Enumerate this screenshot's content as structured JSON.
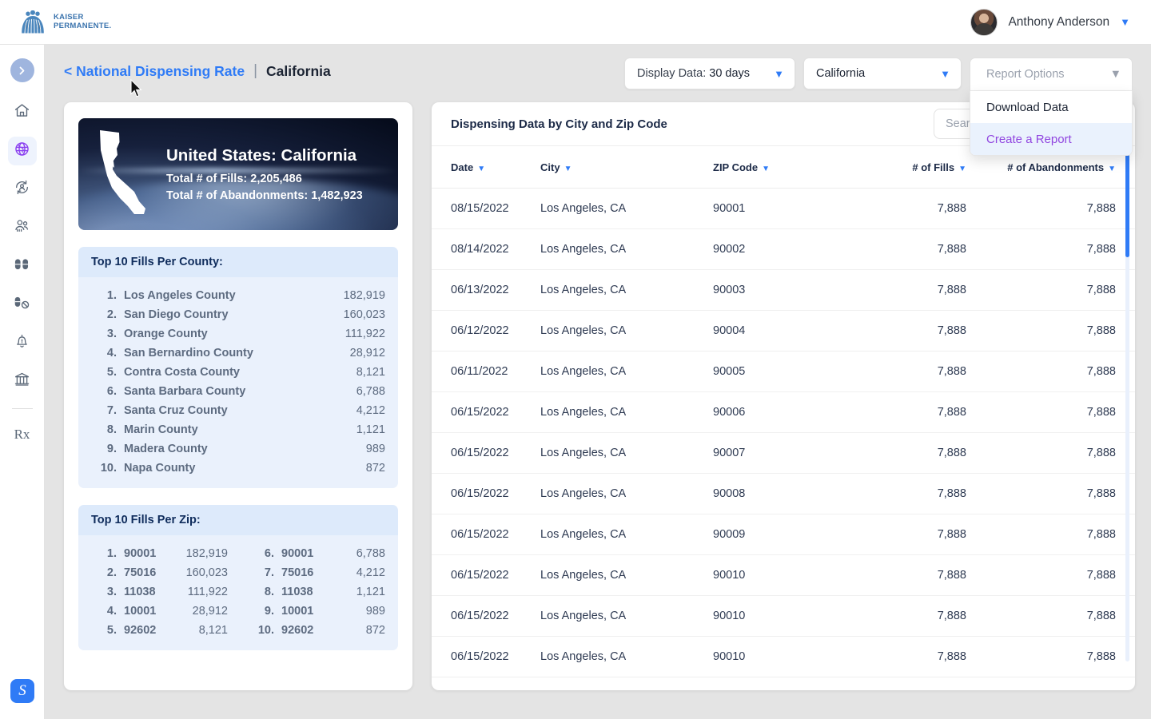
{
  "brand": {
    "line1": "KAISER",
    "line2": "PERMANENTE."
  },
  "user": {
    "name": "Anthony Anderson",
    "caret": "chevron-down-icon"
  },
  "sidebar": {
    "toggle_label": "›",
    "items": [
      {
        "name": "home",
        "label": "Home"
      },
      {
        "name": "globe",
        "label": "National Dispensing Rate",
        "active": true
      },
      {
        "name": "refresh-person",
        "label": "Refills"
      },
      {
        "name": "people",
        "label": "Members"
      },
      {
        "name": "pills",
        "label": "Medications"
      },
      {
        "name": "pill-blocked",
        "label": "Abandonments"
      },
      {
        "name": "bell-alert",
        "label": "Alerts"
      },
      {
        "name": "bank",
        "label": "Institutions"
      },
      {
        "name": "rx",
        "label": "Rx"
      }
    ],
    "logo_letter": "S"
  },
  "breadcrumb": {
    "back_label": "< National Dispensing Rate",
    "separator": "|",
    "current": "California"
  },
  "controls": {
    "display_data": {
      "prefix": "Display Data:",
      "value": "30 days"
    },
    "state": {
      "value": "California"
    },
    "report_options": {
      "label": "Report Options",
      "options": [
        "Download Data",
        "Create a Report"
      ],
      "highlighted": "Create a Report"
    }
  },
  "hero": {
    "title": "United States: California",
    "fills_line": "Total # of Fills: 2,205,486",
    "abandonments_line": "Total # of Abandonments: 1,482,923"
  },
  "county_panel": {
    "title": "Top 10 Fills Per County:",
    "rows": [
      {
        "rank": "1.",
        "name": "Los Angeles County",
        "value": "182,919"
      },
      {
        "rank": "2.",
        "name": "San Diego Country",
        "value": "160,023"
      },
      {
        "rank": "3.",
        "name": "Orange County",
        "value": "111,922"
      },
      {
        "rank": "4.",
        "name": "San Bernardino County",
        "value": "28,912"
      },
      {
        "rank": "5.",
        "name": "Contra Costa County",
        "value": "8,121"
      },
      {
        "rank": "6.",
        "name": "Santa Barbara County",
        "value": "6,788"
      },
      {
        "rank": "7.",
        "name": "Santa Cruz County",
        "value": "4,212"
      },
      {
        "rank": "8.",
        "name": "Marin County",
        "value": "1,121"
      },
      {
        "rank": "9.",
        "name": "Madera County",
        "value": "989"
      },
      {
        "rank": "10.",
        "name": "Napa County",
        "value": "872"
      }
    ]
  },
  "zip_panel": {
    "title": "Top 10 Fills Per Zip:",
    "left": [
      {
        "rank": "1.",
        "name": "90001",
        "value": "182,919"
      },
      {
        "rank": "2.",
        "name": "75016",
        "value": "160,023"
      },
      {
        "rank": "3.",
        "name": "11038",
        "value": "111,922"
      },
      {
        "rank": "4.",
        "name": "10001",
        "value": "28,912"
      },
      {
        "rank": "5.",
        "name": "92602",
        "value": "8,121"
      }
    ],
    "right": [
      {
        "rank": "6.",
        "name": "90001",
        "value": "6,788"
      },
      {
        "rank": "7.",
        "name": "75016",
        "value": "4,212"
      },
      {
        "rank": "8.",
        "name": "11038",
        "value": "1,121"
      },
      {
        "rank": "9.",
        "name": "10001",
        "value": "989"
      },
      {
        "rank": "10.",
        "name": "92602",
        "value": "872"
      }
    ]
  },
  "table": {
    "title": "Dispensing Data by City and Zip Code",
    "search_placeholder": "Search",
    "search_value": "",
    "columns": [
      "Date",
      "City",
      "ZIP Code",
      "# of Fills",
      "# of Abandonments"
    ],
    "rows": [
      [
        "08/15/2022",
        "Los Angeles, CA",
        "90001",
        "7,888",
        "7,888"
      ],
      [
        "08/14/2022",
        "Los Angeles, CA",
        "90002",
        "7,888",
        "7,888"
      ],
      [
        "06/13/2022",
        "Los Angeles, CA",
        "90003",
        "7,888",
        "7,888"
      ],
      [
        "06/12/2022",
        "Los Angeles, CA",
        "90004",
        "7,888",
        "7,888"
      ],
      [
        "06/11/2022",
        "Los Angeles, CA",
        "90005",
        "7,888",
        "7,888"
      ],
      [
        "06/15/2022",
        "Los Angeles, CA",
        "90006",
        "7,888",
        "7,888"
      ],
      [
        "06/15/2022",
        "Los Angeles, CA",
        "90007",
        "7,888",
        "7,888"
      ],
      [
        "06/15/2022",
        "Los Angeles, CA",
        "90008",
        "7,888",
        "7,888"
      ],
      [
        "06/15/2022",
        "Los Angeles, CA",
        "90009",
        "7,888",
        "7,888"
      ],
      [
        "06/15/2022",
        "Los Angeles, CA",
        "90010",
        "7,888",
        "7,888"
      ],
      [
        "06/15/2022",
        "Los Angeles, CA",
        "90010",
        "7,888",
        "7,888"
      ],
      [
        "06/15/2022",
        "Los Angeles, CA",
        "90010",
        "7,888",
        "7,888"
      ]
    ]
  },
  "colors": {
    "accent_blue": "#2f7bf6",
    "accent_purple": "#9146e0",
    "panel_blue": "#eaf1fc",
    "page_bg": "#e4e4e4"
  }
}
